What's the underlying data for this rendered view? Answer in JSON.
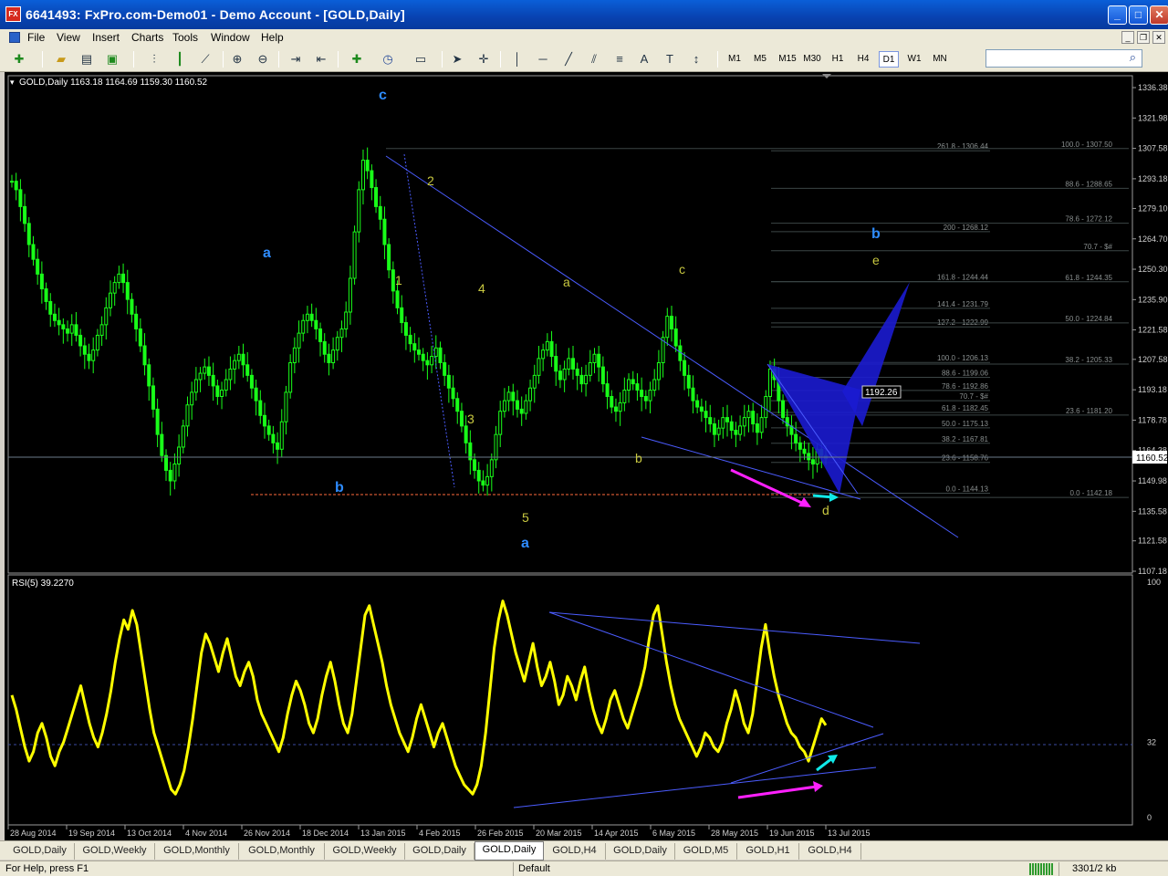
{
  "window": {
    "title": "6641493: FxPro.com-Demo01 - Demo Account - [GOLD,Daily]",
    "app_icon_text": "FX",
    "minimize": "_",
    "maximize": "□",
    "close": "✕"
  },
  "menu": {
    "items": [
      "File",
      "View",
      "Insert",
      "Charts",
      "Tools",
      "Window",
      "Help"
    ],
    "mdi_minimize": "_",
    "mdi_restore": "❐",
    "mdi_close": "✕"
  },
  "toolbar": {
    "timeframes": [
      "M1",
      "M5",
      "M15",
      "M30",
      "H1",
      "H4",
      "D1",
      "W1",
      "MN"
    ],
    "active_timeframe": "D1",
    "text_tool": "A",
    "label_tool": "T"
  },
  "search": {
    "value": "",
    "icon": "search-icon"
  },
  "chart": {
    "symbol_info": "GOLD,Daily  1163.18 1164.69 1159.30 1160.52",
    "current_price_label": "1160.52",
    "target_price_label": "1192.26",
    "price_axis": [
      "1336.38",
      "1321.98",
      "1307.58",
      "1293.18",
      "1279.10",
      "1264.70",
      "1250.30",
      "1235.90",
      "1221.58",
      "1207.58",
      "1193.18",
      "1178.78",
      "1164.38",
      "1149.98",
      "1135.58",
      "1121.58",
      "1107.18"
    ],
    "date_axis": [
      "28 Aug 2014",
      "19 Sep 2014",
      "13 Oct 2014",
      "4 Nov 2014",
      "26 Nov 2014",
      "18 Dec 2014",
      "13 Jan 2015",
      "4 Feb 2015",
      "26 Feb 2015",
      "20 Mar 2015",
      "14 Apr 2015",
      "6 May 2015",
      "28 May 2015",
      "19 Jun 2015",
      "13 Jul 2015"
    ],
    "wave_labels": {
      "blue": [
        "c",
        "a",
        "b",
        "a",
        "b"
      ],
      "yellow": [
        "2",
        "1",
        "4",
        "3",
        "5",
        "a",
        "c",
        "b",
        "e",
        "d"
      ]
    },
    "fib_levels_left": [
      {
        "label": "261.8 - 1306.44",
        "price": 1306.44
      },
      {
        "label": "200 - 1268.12",
        "price": 1268.12
      },
      {
        "label": "161.8 - 1244.44",
        "price": 1244.44
      },
      {
        "label": "141.4 - 1231.79",
        "price": 1231.79
      },
      {
        "label": "127.2 - 1222.99",
        "price": 1222.99
      },
      {
        "label": "100.0 - 1206.13",
        "price": 1206.13
      },
      {
        "label": "88.6 - 1199.06",
        "price": 1199.06
      },
      {
        "label": "78.6 - 1192.86",
        "price": 1192.86
      },
      {
        "label": "70.7 - $#",
        "price": 1188.0
      },
      {
        "label": "61.8 - 1182.45",
        "price": 1182.45
      },
      {
        "label": "50.0 - 1175.13",
        "price": 1175.13
      },
      {
        "label": "38.2 - 1167.81",
        "price": 1167.81
      },
      {
        "label": "23.6 - 1158.76",
        "price": 1158.76
      },
      {
        "label": "0.0 - 1144.13",
        "price": 1144.13
      }
    ],
    "fib_levels_right": [
      {
        "label": "100.0 - 1307.50",
        "price": 1307.5
      },
      {
        "label": "88.6 - 1288.65",
        "price": 1288.65
      },
      {
        "label": "78.6 - 1272.12",
        "price": 1272.12
      },
      {
        "label": "70.7 - $#",
        "price": 1259.06
      },
      {
        "label": "61.8 - 1244.35",
        "price": 1244.35
      },
      {
        "label": "50.0 - 1224.84",
        "price": 1224.84
      },
      {
        "label": "38.2 - 1205.33",
        "price": 1205.33
      },
      {
        "label": "23.6 - 1181.20",
        "price": 1181.2
      },
      {
        "label": "0.0 - 1142.18",
        "price": 1142.18
      }
    ],
    "price_close": [
      1292,
      1288,
      1280,
      1272,
      1262,
      1255,
      1248,
      1241,
      1235,
      1229,
      1226,
      1224,
      1222,
      1220,
      1224,
      1219,
      1214,
      1210,
      1207,
      1212,
      1219,
      1224,
      1232,
      1239,
      1244,
      1248,
      1244,
      1236,
      1229,
      1222,
      1214,
      1205,
      1195,
      1184,
      1172,
      1162,
      1155,
      1150,
      1158,
      1166,
      1176,
      1186,
      1192,
      1198,
      1201,
      1204,
      1200,
      1195,
      1190,
      1193,
      1198,
      1203,
      1207,
      1210,
      1205,
      1200,
      1194,
      1188,
      1181,
      1176,
      1172,
      1168,
      1165,
      1178,
      1192,
      1206,
      1213,
      1220,
      1226,
      1229,
      1226,
      1222,
      1216,
      1210,
      1206,
      1212,
      1218,
      1222,
      1230,
      1246,
      1268,
      1288,
      1302,
      1297,
      1289,
      1280,
      1274,
      1262,
      1250,
      1240,
      1232,
      1225,
      1219,
      1215,
      1212,
      1210,
      1207,
      1205,
      1209,
      1213,
      1206,
      1200,
      1194,
      1189,
      1183,
      1176,
      1168,
      1160,
      1155,
      1150,
      1148,
      1152,
      1160,
      1172,
      1183,
      1188,
      1192,
      1188,
      1184,
      1182,
      1188,
      1194,
      1200,
      1208,
      1212,
      1216,
      1209,
      1202,
      1198,
      1203,
      1208,
      1203,
      1200,
      1196,
      1200,
      1206,
      1210,
      1204,
      1196,
      1190,
      1185,
      1183,
      1187,
      1193,
      1198,
      1196,
      1193,
      1190,
      1188,
      1193,
      1198,
      1206,
      1218,
      1228,
      1222,
      1214,
      1207,
      1200,
      1194,
      1188,
      1185,
      1183,
      1180,
      1177,
      1172,
      1175,
      1180,
      1178,
      1174,
      1172,
      1176,
      1180,
      1183,
      1177,
      1173,
      1180,
      1190,
      1203,
      1198,
      1188,
      1180,
      1176,
      1172,
      1168,
      1165,
      1163,
      1160,
      1158,
      1165,
      1162,
      1160.52
    ],
    "rsi_title": "RSI(5) 39.2270",
    "rsi_axis": [
      "100",
      "32",
      "0"
    ],
    "rsi_values": [
      52,
      46,
      38,
      30,
      24,
      28,
      36,
      40,
      34,
      26,
      22,
      28,
      32,
      38,
      44,
      50,
      56,
      48,
      40,
      34,
      30,
      36,
      44,
      54,
      66,
      76,
      84,
      80,
      88,
      82,
      70,
      58,
      46,
      36,
      30,
      24,
      18,
      12,
      10,
      14,
      20,
      30,
      42,
      56,
      70,
      78,
      74,
      68,
      62,
      70,
      76,
      68,
      60,
      56,
      62,
      66,
      60,
      50,
      44,
      40,
      36,
      32,
      28,
      34,
      44,
      52,
      58,
      54,
      48,
      40,
      36,
      42,
      52,
      60,
      66,
      58,
      48,
      40,
      36,
      44,
      58,
      72,
      86,
      90,
      82,
      74,
      66,
      56,
      48,
      42,
      36,
      32,
      28,
      34,
      42,
      48,
      42,
      36,
      30,
      36,
      40,
      34,
      28,
      22,
      18,
      14,
      12,
      10,
      14,
      22,
      36,
      54,
      72,
      84,
      92,
      86,
      78,
      70,
      64,
      58,
      66,
      74,
      64,
      56,
      60,
      66,
      58,
      48,
      52,
      60,
      56,
      50,
      58,
      64,
      54,
      46,
      40,
      36,
      42,
      50,
      54,
      48,
      42,
      38,
      44,
      50,
      56,
      64,
      76,
      86,
      90,
      78,
      66,
      56,
      48,
      42,
      38,
      34,
      30,
      26,
      30,
      36,
      34,
      30,
      28,
      32,
      40,
      46,
      54,
      48,
      40,
      36,
      44,
      58,
      72,
      82,
      70,
      60,
      52,
      46,
      40,
      36,
      34,
      30,
      28,
      24,
      30,
      36,
      42,
      39.227
    ]
  },
  "tabs": {
    "items": [
      "GOLD,Daily",
      "GOLD,Weekly",
      "GOLD,Monthly",
      "GOLD,Monthly",
      "GOLD,Weekly",
      "GOLD,Daily",
      "GOLD,Daily",
      "GOLD,H4",
      "GOLD,Daily",
      "GOLD,M5",
      "GOLD,H1",
      "GOLD,H4"
    ],
    "active_index": 6
  },
  "status": {
    "help": "For Help, press F1",
    "profile": "Default",
    "traffic": "3301/2 kb"
  },
  "colors": {
    "candles": "#19ff19",
    "rsi_line": "#ffff00",
    "trendline": "#4b5cff",
    "wave_blue": "#2e8cff",
    "wave_yellow": "#c8c840",
    "harmonic_fill": "#1b1bd0",
    "arrow_magenta": "#ff20ff",
    "arrow_cyan": "#10e8e8",
    "support_line": "#ff6a3d"
  }
}
